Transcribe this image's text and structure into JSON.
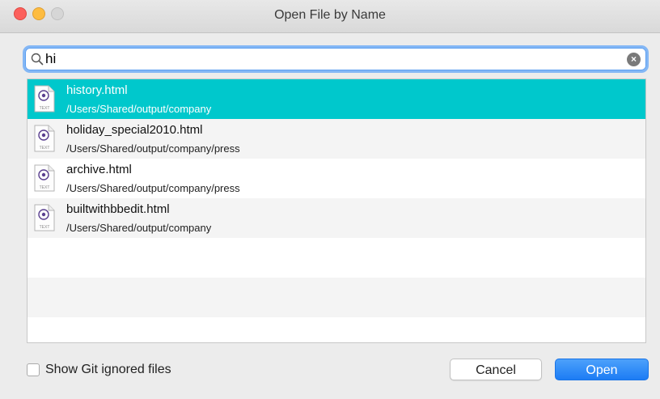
{
  "window": {
    "title": "Open File by Name"
  },
  "search": {
    "value": "hi"
  },
  "results": [
    {
      "name": "history.html",
      "path": "/Users/Shared/output/company",
      "selected": true
    },
    {
      "name": "holiday_special2010.html",
      "path": "/Users/Shared/output/company/press",
      "selected": false
    },
    {
      "name": "archive.html",
      "path": "/Users/Shared/output/company/press",
      "selected": false
    },
    {
      "name": "builtwithbbedit.html",
      "path": "/Users/Shared/output/company",
      "selected": false
    }
  ],
  "file_icon_label": "TEXT",
  "options": {
    "show_git_ignored_label": "Show Git ignored files",
    "show_git_ignored_checked": false
  },
  "buttons": {
    "cancel_label": "Cancel",
    "open_label": "Open"
  },
  "colors": {
    "selection": "#00c8cc",
    "primary_button": "#1c7cf4",
    "focus_ring": "#84b7f5"
  },
  "icons": {
    "search": "magnifier-icon",
    "clear": "clear-x-icon",
    "file": "bbedit-text-file-icon"
  }
}
